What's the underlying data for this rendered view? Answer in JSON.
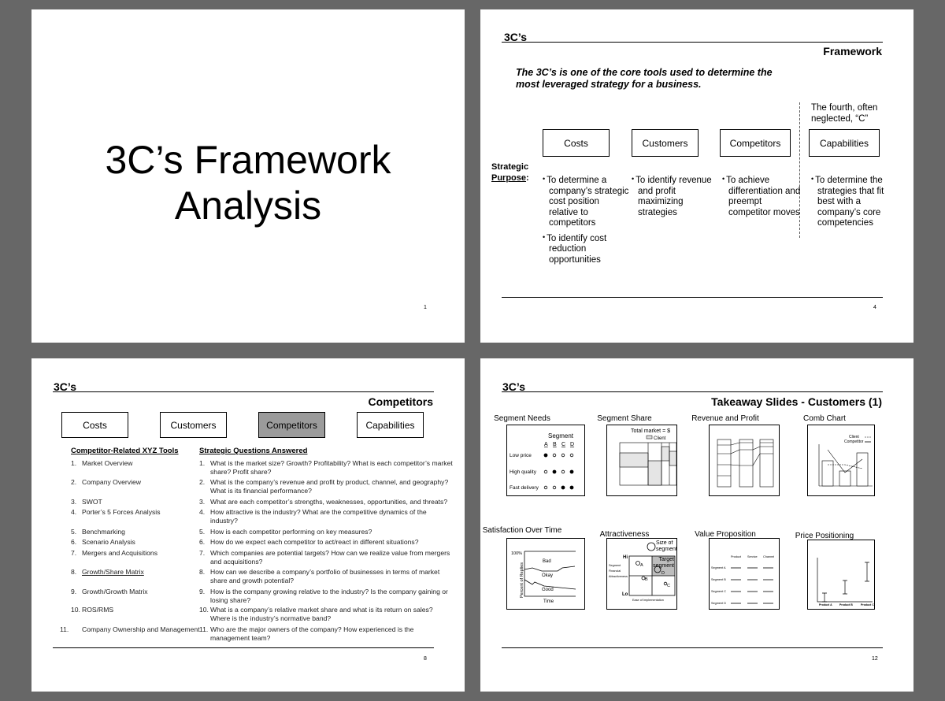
{
  "slide1": {
    "title_line1": "3C’s Framework",
    "title_line2": "Analysis",
    "page": "1"
  },
  "slide2": {
    "section": "3C’s",
    "heading": "Framework",
    "intro_line1": "The 3C’s is one of the core tools used to determine the",
    "intro_line2": "most leveraged strategy for a business.",
    "note_line1": "The fourth, often",
    "note_line2": "neglected, “C”",
    "boxes": [
      "Costs",
      "Customers",
      "Competitors",
      "Capabilities"
    ],
    "purpose_label1": "Strategic",
    "purpose_label2": "Purpose",
    "purpose_colon": ":",
    "bullets": {
      "costs": [
        "To determine a company’s strategic cost position relative to competitors",
        "To identify cost reduction opportunities"
      ],
      "customers": [
        "To identify revenue and profit maximizing strategies"
      ],
      "competitors": [
        "To achieve differentiation and preempt competitor moves"
      ],
      "capabilities": [
        "To determine the strategies that fit best with a company’s core competencies"
      ]
    },
    "page": "4"
  },
  "slide3": {
    "section": "3C’s",
    "heading": "Competitors",
    "boxes": [
      "Costs",
      "Customers",
      "Competitors",
      "Capabilities"
    ],
    "col1_header": "Competitor-Related XYZ Tools",
    "col2_header": "Strategic Questions Answered",
    "tools": [
      "Market Overview",
      "Company Overview",
      "SWOT",
      "Porter’s 5 Forces Analysis",
      "Benchmarking",
      "Scenario Analysis",
      "Mergers and Acquisitions",
      "Growth/Share Matrix",
      "Growth/Growth Matrix",
      "ROS/RMS",
      "Company Ownership and Management"
    ],
    "questions": [
      "What is the market size? Growth?  Profitability? What is each competitor’s market share?  Profit share?",
      "What is the company’s revenue and profit by product, channel, and geography? What is its financial performance?",
      "What are each competitor’s strengths, weaknesses, opportunities, and threats?",
      "How attractive is the industry? What are the competitive dynamics of the industry?",
      "How is each competitor performing on key measures?",
      "How do we expect each competitor to act/react in different situations?",
      "Which companies are potential targets? How can we realize value from mergers and acquisitions?",
      "How can we describe a company’s portfolio of businesses in terms of market share and growth potential?",
      "How is the company growing relative to the industry? Is the company gaining or losing share?",
      "What is a company’s relative market share and what is its return on sales? Where is the industry’s normative band?",
      "Who are the major owners of the company?  How experienced is the management team?"
    ],
    "page": "8"
  },
  "slide4": {
    "section": "3C’s",
    "heading": "Takeaway Slides - Customers (1)",
    "page": "12",
    "thumbs": [
      "Segment Needs",
      "Segment Share",
      "Revenue and Profit",
      "Comb Chart",
      "Satisfaction Over Time",
      "Attractiveness",
      "Value Proposition",
      "Price Positioning"
    ],
    "needs": {
      "segment": "Segment",
      "cols": [
        "A",
        "B",
        "C",
        "D"
      ],
      "rows": [
        "Low price",
        "High quality",
        "Fast delivery"
      ]
    },
    "share": {
      "total": "Total market = $",
      "client": "Client"
    },
    "comb": {
      "client": "Client",
      "competitor": "Competitor"
    },
    "satisfaction": {
      "pct": "100%",
      "ylabel": "Percent of Replies",
      "bad": "Bad",
      "okay": "Okay",
      "good": "Good",
      "x": "Time"
    },
    "attract": {
      "size": "Size of segment",
      "hi": "Hi",
      "lo": "Lo",
      "ylabel1": "Segment",
      "ylabel2": "Financial",
      "ylabel3": "Attractiveness",
      "target": "Target segment",
      "a": "A",
      "b": "B",
      "c": "C",
      "d": "D",
      "x": "Ease of Implementation"
    },
    "value": {
      "cols": [
        "Product",
        "Service",
        "Channel"
      ],
      "rows": [
        "Segment A",
        "Segment B",
        "Segment C",
        "Segment D"
      ]
    },
    "price": {
      "products": [
        "Product A",
        "Product B",
        "Product C"
      ]
    }
  }
}
